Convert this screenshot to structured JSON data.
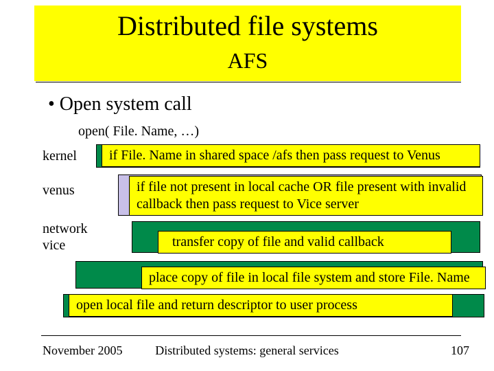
{
  "header": {
    "title": "Distributed file systems",
    "subtitle": "AFS"
  },
  "bullet": "•  Open system call",
  "call": "open( File. Name, …)",
  "labels": {
    "kernel": "kernel",
    "venus": "venus",
    "network": "network",
    "vice": "vice"
  },
  "steps": {
    "s1": "if File. Name in shared space /afs then pass request to Venus",
    "s2": "if file not present in local cache OR file present with invalid callback then pass request to Vice server",
    "s3": "transfer copy of file and valid callback",
    "s4": "place copy of file in local file system and store File. Name",
    "s5": "open local file and return descriptor to user process"
  },
  "footer": {
    "left": "November 2005",
    "center": "Distributed systems: general services",
    "page": "107"
  }
}
